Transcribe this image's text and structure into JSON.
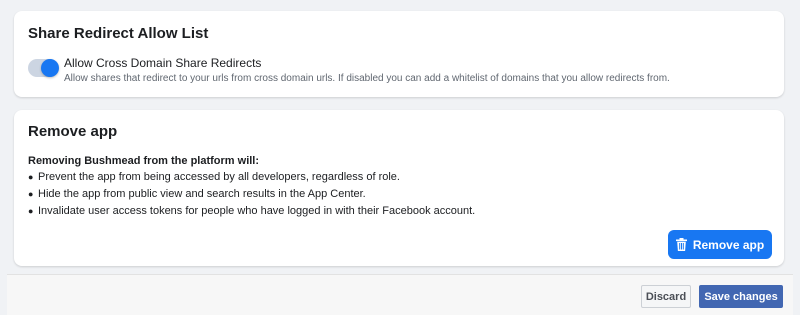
{
  "share_redirect": {
    "title": "Share Redirect Allow List",
    "toggle_label": "Allow Cross Domain Share Redirects",
    "toggle_description": "Allow shares that redirect to your urls from cross domain urls. If disabled you can add a whitelist of domains that you allow redirects from.",
    "toggle_on": true
  },
  "remove_app": {
    "title": "Remove app",
    "intro": "Removing Bushmead from the platform will:",
    "items": [
      "Prevent the app from being accessed by all developers, regardless of role.",
      "Hide the app from public view and search results in the App Center.",
      "Invalidate user access tokens for people who have logged in with their Facebook account."
    ],
    "button_label": "Remove app",
    "button_icon": "trash-icon"
  },
  "footer": {
    "discard_label": "Discard",
    "save_label": "Save changes"
  },
  "colors": {
    "accent": "#1877f2",
    "save_button": "#4267b2",
    "toggle_track": "#ccd5e2"
  }
}
